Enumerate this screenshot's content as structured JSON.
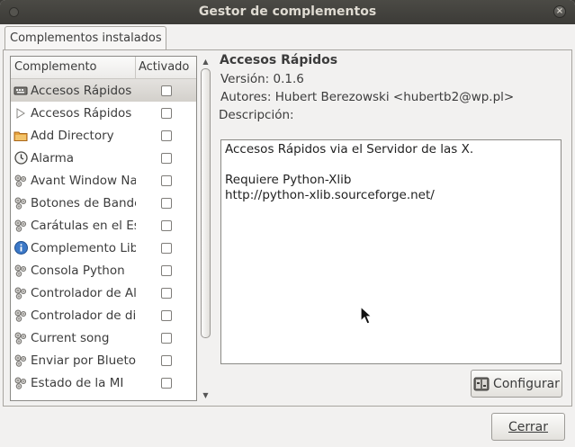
{
  "window": {
    "title": "Gestor de complementos",
    "close_glyph": "×"
  },
  "tabs": [
    {
      "label": "Complementos instalados"
    }
  ],
  "list": {
    "columns": {
      "name": "Complemento",
      "active": "Activado"
    },
    "items": [
      {
        "label": "Accesos Rápidos",
        "icon": "keyboard-icon",
        "checked": false,
        "selected": true
      },
      {
        "label": "Accesos Rápidos de",
        "icon": "play-icon",
        "checked": false
      },
      {
        "label": "Add Directory",
        "icon": "folder-icon",
        "checked": false
      },
      {
        "label": "Alarma",
        "icon": "clock-icon",
        "checked": false
      },
      {
        "label": "Avant Window Navigator",
        "icon": "plugin-icon",
        "checked": false
      },
      {
        "label": "Botones de Bandeja",
        "icon": "plugin-icon",
        "checked": false
      },
      {
        "label": "Carátulas en el Escritorio",
        "icon": "plugin-icon",
        "checked": false
      },
      {
        "label": "Complemento Libre",
        "icon": "info-icon",
        "checked": false
      },
      {
        "label": "Consola Python",
        "icon": "plugin-icon",
        "checked": false
      },
      {
        "label": "Controlador de Alarmas",
        "icon": "plugin-icon",
        "checked": false
      },
      {
        "label": "Controlador de dispositivos",
        "icon": "plugin-icon",
        "checked": false
      },
      {
        "label": "Current song",
        "icon": "plugin-icon",
        "checked": false
      },
      {
        "label": "Enviar por Bluetooth",
        "icon": "plugin-icon",
        "checked": false
      },
      {
        "label": "Estado de la MI",
        "icon": "plugin-icon",
        "checked": false
      }
    ]
  },
  "details": {
    "title": "Accesos Rápidos",
    "version": "Versión: 0.1.6",
    "authors": "Autores: Hubert Berezowski <hubertb2@wp.pl>",
    "description_label": "Descripción:",
    "description": "Accesos Rápidos via el Servidor de las X.\n\nRequiere Python-Xlib\nhttp://python-xlib.sourceforge.net/"
  },
  "buttons": {
    "configure": "Configurar",
    "close": "Cerrar"
  }
}
